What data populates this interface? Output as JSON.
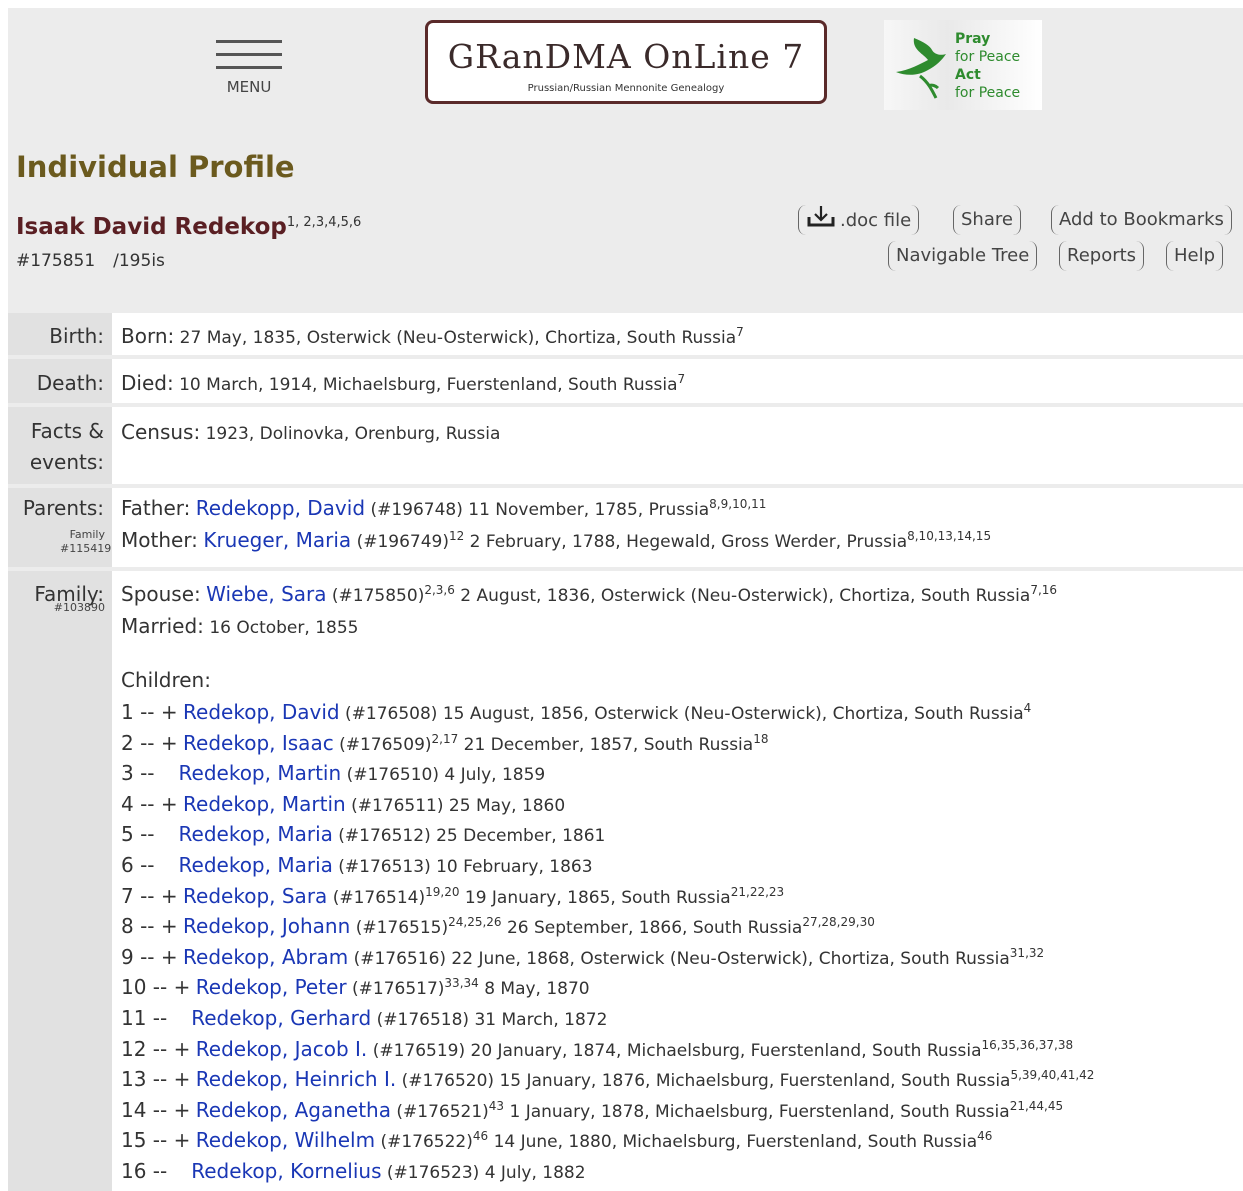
{
  "header": {
    "menu_label": "MENU",
    "logo_title": "GRanDMA OnLine 7",
    "logo_subtitle": "Prussian/Russian Mennonite Genealogy",
    "peace_lines": [
      "Pray",
      "for Peace",
      "Act",
      "for Peace"
    ]
  },
  "page_title": "Individual Profile",
  "person": {
    "name": "Isaak David Redekop",
    "name_refs": "1, 2,3,4,5,6",
    "id": "#175851",
    "code": "/195is"
  },
  "actions": {
    "doc": ".doc file",
    "share": "Share",
    "bookmarks": "Add to Bookmarks",
    "tree": "Navigable Tree",
    "reports": "Reports",
    "help": "Help"
  },
  "birth": {
    "label": "Birth:",
    "key": "Born:",
    "text": "27 May, 1835, Osterwick (Neu-Osterwick), Chortiza, South Russia",
    "refs": "7"
  },
  "death": {
    "label": "Death:",
    "key": "Died:",
    "text": "10 March, 1914, Michaelsburg, Fuerstenland, South Russia",
    "refs": "7"
  },
  "facts": {
    "label1": "Facts &",
    "label2": "events:",
    "key": "Census:",
    "text": "1923, Dolinovka, Orenburg, Russia"
  },
  "parents": {
    "label": "Parents:",
    "family_label": "Family",
    "family_id": "#115419",
    "father_key": "Father:",
    "father_name": "Redekopp, David",
    "father_id": "(#196748)",
    "father_text": "11 November, 1785, Prussia",
    "father_refs": "8,9,10,11",
    "mother_key": "Mother:",
    "mother_name": "Krueger, Maria",
    "mother_id": "(#196749)",
    "mother_id_refs": "12",
    "mother_text": "2 February, 1788, Hegewald, Gross Werder, Prussia",
    "mother_refs": "8,10,13,14,15"
  },
  "family": {
    "label": "Family:",
    "family_id": "#103890",
    "spouse_key": "Spouse:",
    "spouse_name": "Wiebe, Sara",
    "spouse_id": "(#175850)",
    "spouse_id_refs": "2,3,6",
    "spouse_text": "2 August, 1836, Osterwick (Neu-Osterwick), Chortiza, South Russia",
    "spouse_refs": "7,16",
    "married_key": "Married:",
    "married_text": "16 October, 1855",
    "children_label": "Children:",
    "children": [
      {
        "prefix": "1 -- +",
        "name": "Redekop, David",
        "id": "(#176508)",
        "id_refs": "",
        "text": "15 August, 1856, Osterwick (Neu-Osterwick), Chortiza, South Russia",
        "refs": "4"
      },
      {
        "prefix": "2 -- +",
        "name": "Redekop, Isaac",
        "id": "(#176509)",
        "id_refs": "2,17",
        "text": "21 December, 1857, South Russia",
        "refs": "18"
      },
      {
        "prefix": "3 --",
        "name": "Redekop, Martin",
        "id": "(#176510)",
        "id_refs": "",
        "text": "4 July, 1859",
        "refs": ""
      },
      {
        "prefix": "4 -- +",
        "name": "Redekop, Martin",
        "id": "(#176511)",
        "id_refs": "",
        "text": "25 May, 1860",
        "refs": ""
      },
      {
        "prefix": "5 --",
        "name": "Redekop, Maria",
        "id": "(#176512)",
        "id_refs": "",
        "text": "25 December, 1861",
        "refs": ""
      },
      {
        "prefix": "6 --",
        "name": "Redekop, Maria",
        "id": "(#176513)",
        "id_refs": "",
        "text": "10 February, 1863",
        "refs": ""
      },
      {
        "prefix": "7 -- +",
        "name": "Redekop, Sara",
        "id": "(#176514)",
        "id_refs": "19,20",
        "text": "19 January, 1865, South Russia",
        "refs": "21,22,23"
      },
      {
        "prefix": "8 -- +",
        "name": "Redekop, Johann",
        "id": "(#176515)",
        "id_refs": "24,25,26",
        "text": "26 September, 1866, South Russia",
        "refs": "27,28,29,30"
      },
      {
        "prefix": "9 -- +",
        "name": "Redekop, Abram",
        "id": "(#176516)",
        "id_refs": "",
        "text": "22 June, 1868, Osterwick (Neu-Osterwick), Chortiza, South Russia",
        "refs": "31,32"
      },
      {
        "prefix": "10 -- +",
        "name": "Redekop, Peter",
        "id": "(#176517)",
        "id_refs": "33,34",
        "text": "8 May, 1870",
        "refs": ""
      },
      {
        "prefix": "11 --",
        "name": "Redekop, Gerhard",
        "id": "(#176518)",
        "id_refs": "",
        "text": "31 March, 1872",
        "refs": ""
      },
      {
        "prefix": "12 -- +",
        "name": "Redekop, Jacob I.",
        "id": "(#176519)",
        "id_refs": "",
        "text": "20 January, 1874, Michaelsburg, Fuerstenland, South Russia",
        "refs": "16,35,36,37,38"
      },
      {
        "prefix": "13 -- +",
        "name": "Redekop, Heinrich I.",
        "id": "(#176520)",
        "id_refs": "",
        "text": "15 January, 1876, Michaelsburg, Fuerstenland, South Russia",
        "refs": "5,39,40,41,42"
      },
      {
        "prefix": "14 -- +",
        "name": "Redekop, Aganetha",
        "id": "(#176521)",
        "id_refs": "43",
        "text": "1 January, 1878, Michaelsburg, Fuerstenland, South Russia",
        "refs": "21,44,45"
      },
      {
        "prefix": "15 -- +",
        "name": "Redekop, Wilhelm",
        "id": "(#176522)",
        "id_refs": "46",
        "text": "14 June, 1880, Michaelsburg, Fuerstenland, South Russia",
        "refs": "46"
      },
      {
        "prefix": "16 --",
        "name": "Redekop, Kornelius",
        "id": "(#176523)",
        "id_refs": "",
        "text": "4 July, 1882",
        "refs": ""
      }
    ]
  }
}
